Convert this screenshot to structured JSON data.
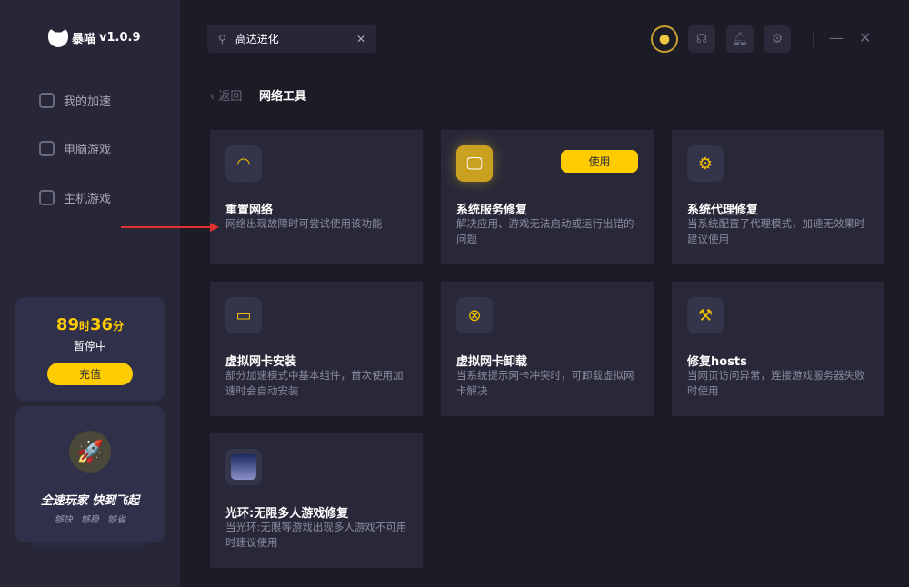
{
  "app": {
    "brand": "暴喵",
    "version": "v1.0.9"
  },
  "sidebar": {
    "items": [
      {
        "label": "我的加速"
      },
      {
        "label": "电脑游戏"
      },
      {
        "label": "主机游戏"
      }
    ]
  },
  "account": {
    "hours": "89",
    "hours_unit": "时",
    "minutes": "36",
    "minutes_unit": "分",
    "status": "暂停中",
    "charge_label": "充值"
  },
  "promo": {
    "slogan": "全速玩家  快到飞起",
    "sub": "够快 够稳 够省"
  },
  "search": {
    "value": "高达进化"
  },
  "nav": {
    "back_label": "返回",
    "page_title": "网络工具"
  },
  "cards": [
    {
      "name": "重置网络",
      "desc": "网络出现故障时可尝试使用该功能",
      "icon": "router-icon"
    },
    {
      "name": "系统服务修复",
      "desc": "解决应用、游戏无法启动或运行出错的问题",
      "icon": "monitor-tools-icon",
      "action": "使用"
    },
    {
      "name": "系统代理修复",
      "desc": "当系统配置了代理模式，加速无效果时建议使用",
      "icon": "monitor-gear-icon"
    },
    {
      "name": "虚拟网卡安装",
      "desc": "部分加速模式中基本组件，首次使用加速时会自动安装",
      "icon": "network-card-icon"
    },
    {
      "name": "虚拟网卡卸载",
      "desc": "当系统提示网卡冲突时，可卸载虚拟网卡解决",
      "icon": "network-card-remove-icon"
    },
    {
      "name": "修复hosts",
      "desc": "当网页访问异常，连接游戏服务器失败时使用",
      "icon": "browser-tools-icon"
    },
    {
      "name": "光环:无限多人游戏修复",
      "desc": "当光环:无限等游戏出现多人游戏不可用时建议使用",
      "icon": "halo-game-icon"
    }
  ],
  "colors": {
    "accent": "#ffcc00",
    "annotation": "#e03030"
  }
}
